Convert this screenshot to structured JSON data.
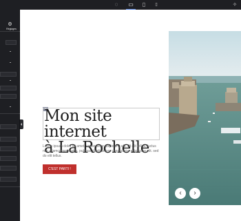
{
  "topbar": {
    "devices": [
      {
        "name": "settings-device",
        "icon": "gear-circle-icon",
        "glyph": "◌"
      },
      {
        "name": "desktop",
        "icon": "desktop-icon",
        "glyph": "▭",
        "active": true
      },
      {
        "name": "tablet",
        "icon": "tablet-icon",
        "glyph": "▯"
      },
      {
        "name": "mobile",
        "icon": "mobile-icon",
        "glyph": "▯"
      }
    ],
    "right_icon": {
      "icon": "sparkle-icon",
      "glyph": "✧"
    }
  },
  "sidebar": {
    "header_icon": "gear-icon",
    "header_glyph": "⚙",
    "header_label": "Réglages",
    "theme_color": "#1e1f23"
  },
  "hero": {
    "edit_badge_glyph": "✎",
    "title_line1": "Mon site internet",
    "title_line2": "à La Rochelle",
    "body": "Lorem ipsum dolor sit amet, consectetur adipiscing elit. Ut elit tellus, luctus nec ullamcorper mattis, pulvinar dapibus leo. consectetur adipiscing elit. sed do elit tellus.",
    "cta_label": "C'EST PARTI !",
    "cta_color": "#c0302d"
  },
  "slider": {
    "prev_glyph": "‹",
    "next_glyph": "›",
    "prev_icon": "chevron-left-icon",
    "next_icon": "chevron-right-icon"
  }
}
